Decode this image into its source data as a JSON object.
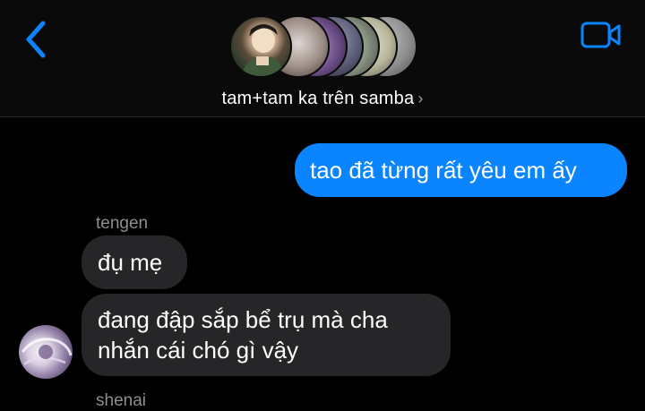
{
  "header": {
    "group_name": "tam+tam ka trên samba",
    "chevron": "›",
    "back_icon": "chevron-left-icon",
    "video_icon": "video-camera-icon",
    "accent": "#0b84ff"
  },
  "messages": {
    "outgoing_1": "tao đã từng rất yêu em ấy",
    "sender_1": "tengen",
    "incoming_1": "đụ mẹ",
    "incoming_2_line1": "đang đập sắp bể trụ mà cha",
    "incoming_2_line2": "nhắn cái chó gì vậy",
    "sender_2_partial": "shenai"
  },
  "colors": {
    "background": "#000000",
    "outgoing_bubble": "#0b84ff",
    "incoming_bubble": "#262628",
    "sender_label": "#8e8e93"
  }
}
